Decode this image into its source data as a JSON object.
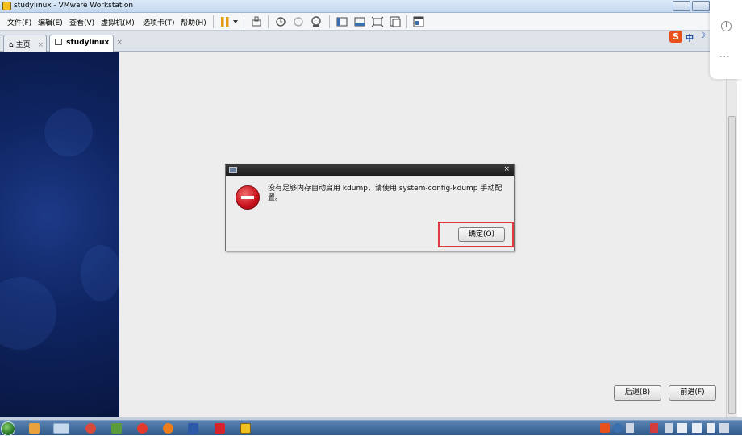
{
  "window": {
    "title": "studylinux - VMware Workstation"
  },
  "menu": [
    {
      "label": "文件(F)"
    },
    {
      "label": "编辑(E)"
    },
    {
      "label": "查看(V)"
    },
    {
      "label": "虚拟机(M)"
    },
    {
      "label": "选项卡(T)"
    },
    {
      "label": "帮助(H)"
    }
  ],
  "tabs": [
    {
      "label": "主页",
      "close": "×"
    },
    {
      "label": "studylinux",
      "close": "×"
    }
  ],
  "ime": {
    "label": "中"
  },
  "dialog": {
    "message": "没有足够内存自动启用 kdump，请使用 system-config-kdump 手动配置。",
    "close": "×",
    "ok_label": "确定(O)"
  },
  "nav": {
    "back_label": "后退(B)",
    "next_label": "前进(F)"
  },
  "colors": {
    "highlight": "#e0393e",
    "sidebar": "#0f2563",
    "guest_bg": "#ededed"
  },
  "icons": {
    "toolbar": [
      "pause-icon",
      "dropdown-arrow-icon",
      "send-keys-icon",
      "snapshot-icon",
      "revert-snapshot-icon",
      "snapshot-manager-icon",
      "full-screen-icon",
      "unity-icon",
      "fit-guest-icon",
      "console-view-icon",
      "thumbnail-icon"
    ],
    "panel": [
      "info-icon",
      "more-icon"
    ],
    "taskbar": [
      "start-icon",
      "task-icon-1",
      "task-icon-2",
      "task-icon-3",
      "task-icon-4",
      "task-icon-5",
      "task-icon-6",
      "task-icon-7",
      "task-icon-8",
      "task-icon-9"
    ]
  }
}
